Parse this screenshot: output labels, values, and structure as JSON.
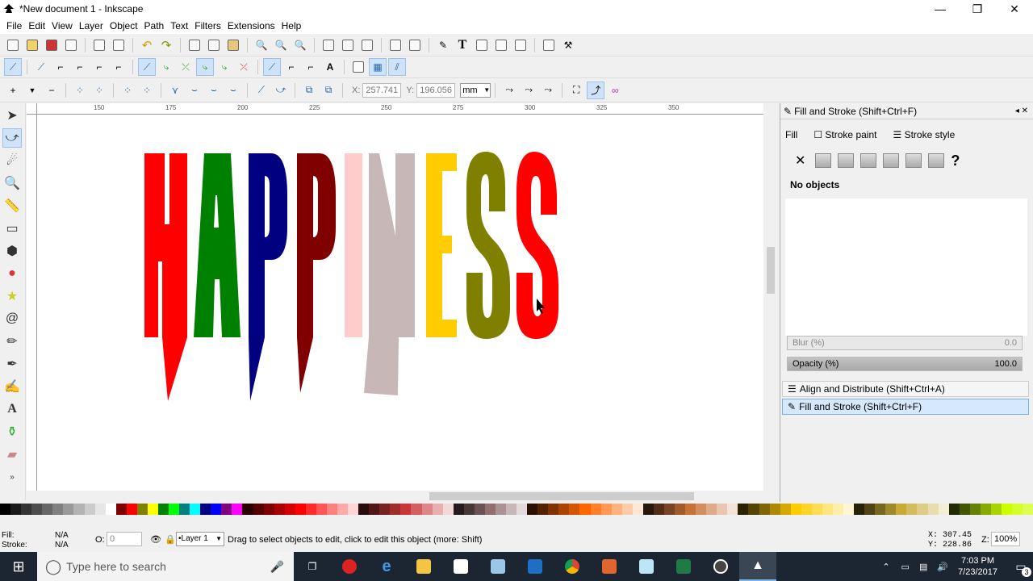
{
  "window": {
    "title": "*New document 1 - Inkscape",
    "minimize": "—",
    "maximize": "❐",
    "close": "✕"
  },
  "menu": [
    "File",
    "Edit",
    "View",
    "Layer",
    "Object",
    "Path",
    "Text",
    "Filters",
    "Extensions",
    "Help"
  ],
  "node_toolbar": {
    "x_label": "X:",
    "x_value": "257.741",
    "y_label": "Y:",
    "y_value": "196.056",
    "unit": "mm"
  },
  "ruler_labels": [
    "150",
    "175",
    "200",
    "225",
    "250",
    "275",
    "300",
    "325",
    "350"
  ],
  "canvas": {
    "text": "HAPPINESS",
    "letters": [
      {
        "char": "H",
        "color": "#ff0000"
      },
      {
        "char": "A",
        "color": "#008000"
      },
      {
        "char": "P",
        "color": "#000080"
      },
      {
        "char": "P",
        "color": "#800000"
      },
      {
        "char": "I",
        "color": "#ffcccc"
      },
      {
        "char": "N",
        "color": "#c8b7b7"
      },
      {
        "char": "E",
        "color": "#ffcc00"
      },
      {
        "char": "S",
        "color": "#808000"
      },
      {
        "char": "S",
        "color": "#ff0000"
      }
    ]
  },
  "dock": {
    "header": "Fill and Stroke (Shift+Ctrl+F)",
    "tabs": [
      "Fill",
      "Stroke paint",
      "Stroke style"
    ],
    "no_paint_symbol": "✕",
    "unknown_symbol": "?",
    "status": "No objects",
    "blur_label": "Blur (%)",
    "blur_value": "0.0",
    "opacity_label": "Opacity (%)",
    "opacity_value": "100.0",
    "collapsed": [
      "Align and Distribute (Shift+Ctrl+A)",
      "Fill and Stroke (Shift+Ctrl+F)"
    ]
  },
  "status": {
    "fill_label": "Fill:",
    "fill_value": "N/A",
    "stroke_label": "Stroke:",
    "stroke_value": "N/A",
    "opacity_label": "O:",
    "opacity_value": "0",
    "layer": "•Layer 1",
    "message": "Drag to select objects to edit, click to edit this object (more: Shift)",
    "cursor_x_label": "X:",
    "cursor_x": "307.45",
    "cursor_y_label": "Y:",
    "cursor_y": "228.86",
    "zoom_label": "Z:",
    "zoom": "100%"
  },
  "taskbar": {
    "search_placeholder": "Type here to search",
    "time": "7:03 PM",
    "date": "7/23/2017",
    "notifications": "3"
  },
  "palette_colors": [
    "#000000",
    "#1a1a1a",
    "#333333",
    "#4d4d4d",
    "#666666",
    "#808080",
    "#999999",
    "#b3b3b3",
    "#cccccc",
    "#e6e6e6",
    "#ffffff",
    "#800000",
    "#ff0000",
    "#808000",
    "#ffff00",
    "#008000",
    "#00ff00",
    "#008080",
    "#00ffff",
    "#000080",
    "#0000ff",
    "#800080",
    "#ff00ff",
    "#2b0000",
    "#550000",
    "#800000",
    "#aa0000",
    "#d40000",
    "#ff0000",
    "#ff2a2a",
    "#ff5555",
    "#ff8080",
    "#ffaaaa",
    "#ffd5d5",
    "#280b0b",
    "#501616",
    "#782121",
    "#a02c2c",
    "#c83737",
    "#d35f5f",
    "#de8787",
    "#e9afaf",
    "#f4d7d7",
    "#241c1c",
    "#483737",
    "#6c5353",
    "#916f6f",
    "#ac9393",
    "#c8b7b7",
    "#e3dbdb",
    "#2b1100",
    "#552200",
    "#803300",
    "#aa4400",
    "#d45500",
    "#ff6600",
    "#ff7f2a",
    "#ff9955",
    "#ffb380",
    "#ffccaa",
    "#ffe6d5",
    "#28170b",
    "#502d16",
    "#784421",
    "#a05a2c",
    "#c87137",
    "#d38d5f",
    "#deaa87",
    "#e9c6af",
    "#f4e3d7",
    "#2b2200",
    "#554400",
    "#806600",
    "#aa8800",
    "#d4aa00",
    "#ffcc00",
    "#ffd42a",
    "#ffdd55",
    "#ffe680",
    "#ffeeaa",
    "#fff6d5",
    "#28220b",
    "#504416",
    "#786721",
    "#a0892c",
    "#c8ab37",
    "#d3bc5f",
    "#decd87",
    "#e9ddaf",
    "#f4eed7",
    "#222b00",
    "#445500",
    "#668000",
    "#88aa00",
    "#aad400",
    "#ccff00",
    "#d4ff2a",
    "#ddff55"
  ]
}
